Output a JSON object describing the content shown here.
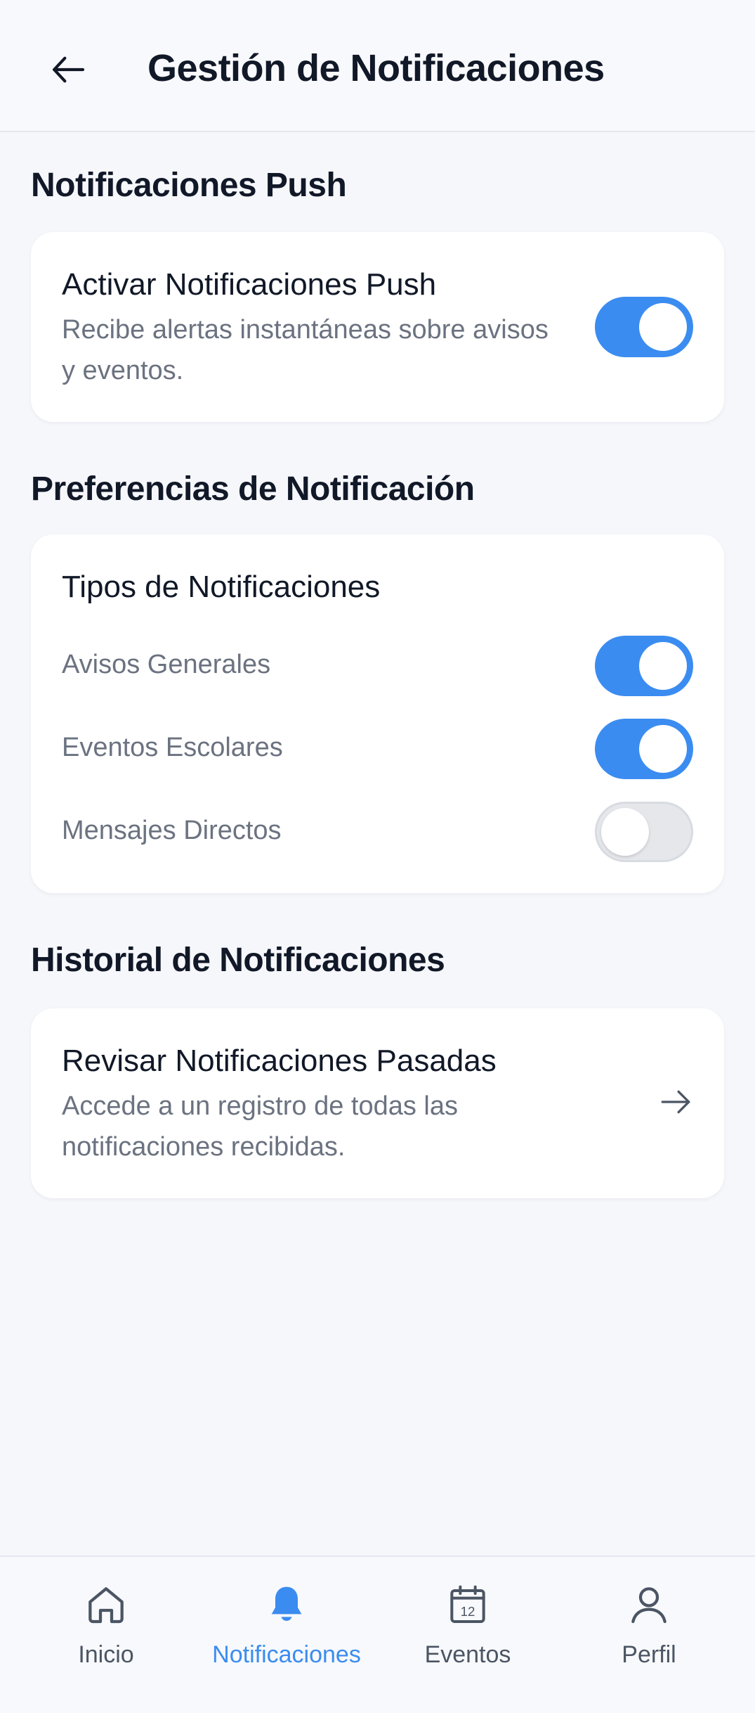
{
  "header": {
    "title": "Gestión de Notificaciones",
    "back_icon": "arrow-left-icon"
  },
  "push_section": {
    "title": "Notificaciones Push",
    "card": {
      "title": "Activar Notificaciones Push",
      "description": "Recibe alertas instantáneas sobre avisos y eventos.",
      "enabled": true
    }
  },
  "preferences_section": {
    "title": "Preferencias de Notificación",
    "card_title": "Tipos de Notificaciones",
    "items": [
      {
        "label": "Avisos Generales",
        "enabled": true
      },
      {
        "label": "Eventos Escolares",
        "enabled": true
      },
      {
        "label": "Mensajes Directos",
        "enabled": false
      }
    ]
  },
  "history_section": {
    "title": "Historial de Notificaciones",
    "card": {
      "title": "Revisar Notificaciones Pasadas",
      "description": "Accede a un registro de todas las notificaciones recibidas.",
      "icon": "arrow-right-icon"
    }
  },
  "bottom_nav": {
    "items": [
      {
        "label": "Inicio",
        "icon": "home-icon",
        "active": false
      },
      {
        "label": "Notificaciones",
        "icon": "bell-icon",
        "active": true
      },
      {
        "label": "Eventos",
        "icon": "calendar-icon",
        "active": false,
        "icon_text": "12"
      },
      {
        "label": "Perfil",
        "icon": "user-icon",
        "active": false
      }
    ]
  },
  "colors": {
    "accent": "#3b8cf0",
    "background": "#f6f7fb",
    "card": "#ffffff",
    "text_primary": "#111827",
    "text_secondary": "#6b7280"
  }
}
